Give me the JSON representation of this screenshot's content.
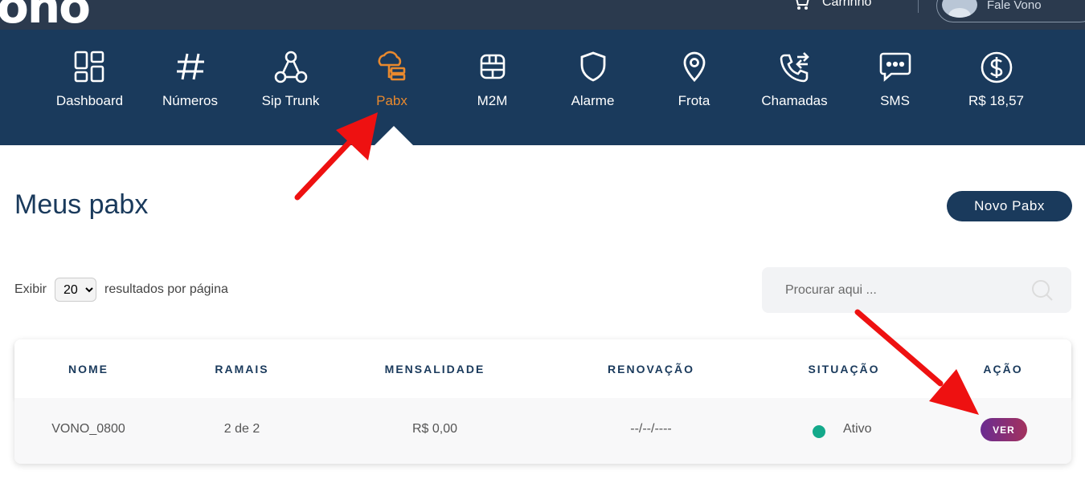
{
  "topbar": {
    "logo": "ono",
    "cart_label": "Carrinho",
    "user_label": "Fale Vono"
  },
  "nav": {
    "items": [
      {
        "label": "Dashboard",
        "icon": "dashboard-icon"
      },
      {
        "label": "Números",
        "icon": "hash-icon"
      },
      {
        "label": "Sip Trunk",
        "icon": "sip-trunk-icon"
      },
      {
        "label": "Pabx",
        "icon": "pabx-icon",
        "active": true
      },
      {
        "label": "M2M",
        "icon": "sim-chip-icon"
      },
      {
        "label": "Alarme",
        "icon": "shield-icon"
      },
      {
        "label": "Frota",
        "icon": "location-pin-icon"
      },
      {
        "label": "Chamadas",
        "icon": "phone-transfer-icon"
      },
      {
        "label": "SMS",
        "icon": "chat-bubble-icon"
      },
      {
        "label": "R$ 18,57",
        "icon": "dollar-icon"
      }
    ],
    "active_color": "#e8892e"
  },
  "main": {
    "title": "Meus pabx",
    "new_button": "Novo Pabx",
    "show_label": "Exibir",
    "per_page_value": "20",
    "per_page_suffix": "resultados por página",
    "search_placeholder": "Procurar aqui ..."
  },
  "table": {
    "headers": [
      "NOME",
      "RAMAIS",
      "MENSALIDADE",
      "RENOVAÇÃO",
      "SITUAÇÃO",
      "AÇÃO"
    ],
    "rows": [
      {
        "nome": "VONO_0800",
        "ramais": "2 de 2",
        "mensalidade": "R$ 0,00",
        "renovacao": "--/--/----",
        "situacao": "Ativo",
        "acao": "VER"
      }
    ]
  },
  "colors": {
    "brand_dark": "#1a3a5c",
    "status_active": "#14a98b",
    "annotation_arrow": "#ee1111"
  }
}
